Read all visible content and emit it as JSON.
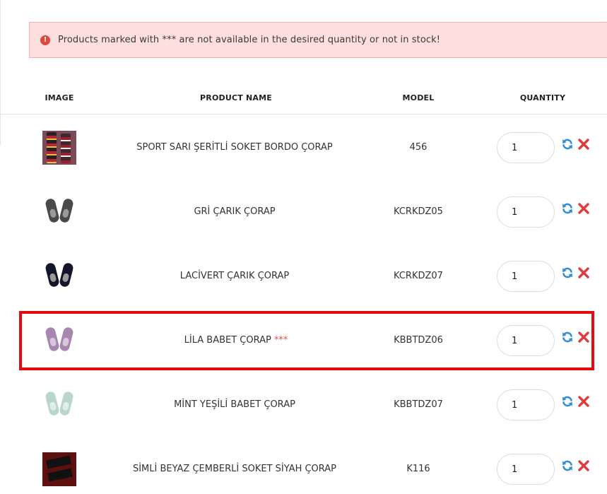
{
  "alert": {
    "icon": "exclamation-circle-icon",
    "message": "Products marked with *** are not available in the desired quantity or not in stock!"
  },
  "table": {
    "headers": {
      "image": "IMAGE",
      "name": "PRODUCT NAME",
      "model": "MODEL",
      "quantity": "QUANTITY"
    },
    "rows": [
      {
        "name": "SPORT SARI ŞERİTLİ SOKET BORDO ÇORAP",
        "stars": "",
        "model": "456",
        "quantity": "1",
        "image": "striped-sock-image"
      },
      {
        "name": "GRİ ÇARIK ÇORAP",
        "stars": "",
        "model": "KCRKDZ05",
        "quantity": "1",
        "image": "gray-liner-sock-image",
        "color": "#4a4a4a"
      },
      {
        "name": "LACİVERT ÇARIK ÇORAP",
        "stars": "",
        "model": "KCRKDZ07",
        "quantity": "1",
        "image": "navy-liner-sock-image",
        "color": "#14172a"
      },
      {
        "name": "LİLA BABET ÇORAP",
        "stars": "***",
        "model": "KBBTDZ06",
        "quantity": "1",
        "image": "lilac-liner-sock-image",
        "color": "#a886b0"
      },
      {
        "name": "MİNT YEŞİLİ BABET ÇORAP",
        "stars": "",
        "model": "KBBTDZ07",
        "quantity": "1",
        "image": "mint-liner-sock-image",
        "color": "#b9d6cc"
      },
      {
        "name": "SİMLİ BEYAZ ÇEMBERLİ SOKET SİYAH ÇORAP",
        "stars": "",
        "model": "K116",
        "quantity": "1",
        "image": "black-sock-image"
      }
    ]
  },
  "colors": {
    "alert_bg": "#ffdede",
    "alert_icon": "#e0463a",
    "refresh_icon": "#2f8fd6",
    "remove_icon": "#e03a3a",
    "highlight": "#e30d0d"
  }
}
